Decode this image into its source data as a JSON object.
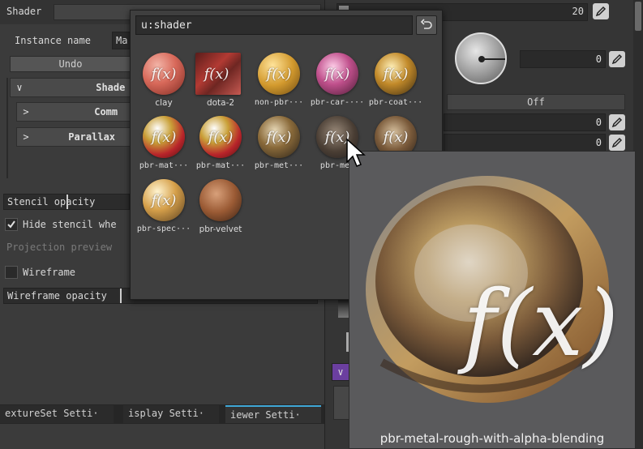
{
  "left": {
    "header_title": "Shader",
    "instance_label": "Instance name",
    "instance_value": "Ma",
    "undo_label": "Undo",
    "group_shader": "Shade",
    "group_common": "Comm",
    "group_parallax": "Parallax",
    "stencil_opacity_label": "Stencil opacity",
    "hide_stencil_label": "Hide stencil whe",
    "hide_stencil_checked": true,
    "projection_preview_label": "Projection preview",
    "wireframe_label": "Wireframe",
    "wireframe_checked": false,
    "wireframe_opacity_label": "Wireframe opacity"
  },
  "bottom_tabs": [
    {
      "label": "extureSet Setti·"
    },
    {
      "label": "isplay Setti·"
    },
    {
      "label": "iewer Setti·"
    }
  ],
  "right": {
    "top_value": "20",
    "dial_value": "0",
    "off_label": "Off",
    "value_1": "0",
    "value_2": "0"
  },
  "popup": {
    "search_value": "u:shader",
    "shaders": [
      {
        "label": "clay"
      },
      {
        "label": "dota-2"
      },
      {
        "label": "non-pbr···"
      },
      {
        "label": "pbr-car-···"
      },
      {
        "label": "pbr-coat···"
      },
      {
        "label": "pbr-mat···"
      },
      {
        "label": "pbr-mat···"
      },
      {
        "label": "pbr-met···"
      },
      {
        "label": "pbr-met"
      },
      {
        "label": ""
      },
      {
        "label": "pbr-spec···"
      },
      {
        "label": "pbr-velvet"
      }
    ]
  },
  "preview": {
    "fx_text": "f(x)",
    "caption": "pbr-metal-rough-with-alpha-blending"
  },
  "colors": {
    "accent_underline": "#3fa7d6",
    "wireframe_button": "#6b3fa0"
  }
}
